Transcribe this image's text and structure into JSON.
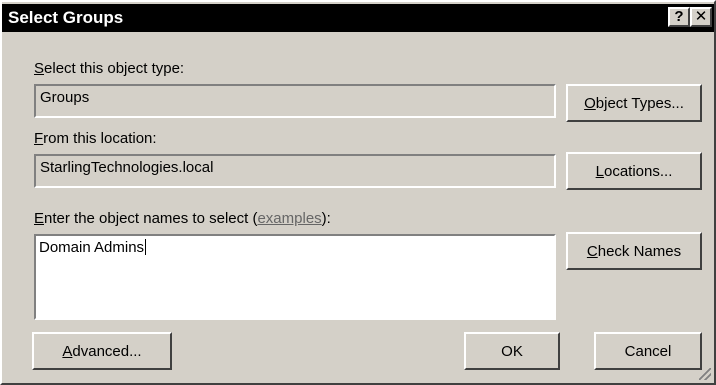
{
  "window": {
    "title": "Select Groups",
    "help_glyph": "?",
    "close_glyph": "✕"
  },
  "object_type": {
    "label_accel": "S",
    "label_rest": "elect this object type:",
    "value": "Groups",
    "button_accel": "O",
    "button_rest": "bject Types..."
  },
  "location": {
    "label_accel": "F",
    "label_rest": "rom this location:",
    "value": "StarlingTechnologies.local",
    "button_accel": "L",
    "button_rest": "ocations..."
  },
  "names": {
    "label_accel": "E",
    "label_rest": "nter the object names to select (",
    "label_link": "examples",
    "label_end": "):",
    "value": "Domain Admins",
    "button_accel": "C",
    "button_rest": "heck Names"
  },
  "footer": {
    "advanced_accel": "A",
    "advanced_rest": "dvanced...",
    "ok_label": "OK",
    "cancel_label": "Cancel"
  },
  "colors": {
    "face": "#d4d0c8",
    "title_bg": "#000000",
    "title_fg": "#ffffff"
  }
}
